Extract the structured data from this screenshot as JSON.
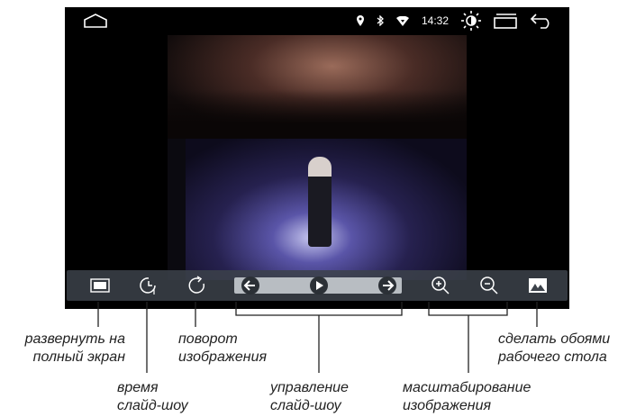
{
  "status": {
    "time": "14:32",
    "icons": [
      "home-icon",
      "location-icon",
      "bluetooth-icon",
      "wifi-icon",
      "brightness-icon",
      "recent-apps-icon",
      "back-icon"
    ]
  },
  "toolbar": {
    "buttons": [
      "fullscreen-icon",
      "slideshow-timer-icon",
      "rotate-icon",
      "prev-arrow-icon",
      "play-icon",
      "next-arrow-icon",
      "zoom-in-icon",
      "zoom-out-icon",
      "wallpaper-icon"
    ]
  },
  "annotations": {
    "fullscreen": [
      "развернуть на",
      "полный экран"
    ],
    "timer": [
      "время",
      "слайд-шоу"
    ],
    "rotate": [
      "поворот",
      "изображения"
    ],
    "slideshow": [
      "управление",
      "слайд-шоу"
    ],
    "zoom": [
      "масштабирование",
      "изображения"
    ],
    "wallpaper": [
      "сделать обоями",
      "рабочего стола"
    ]
  },
  "colors": {
    "toolbar": "#3c424a",
    "screen": "#000000",
    "accent": "#ffffff"
  }
}
